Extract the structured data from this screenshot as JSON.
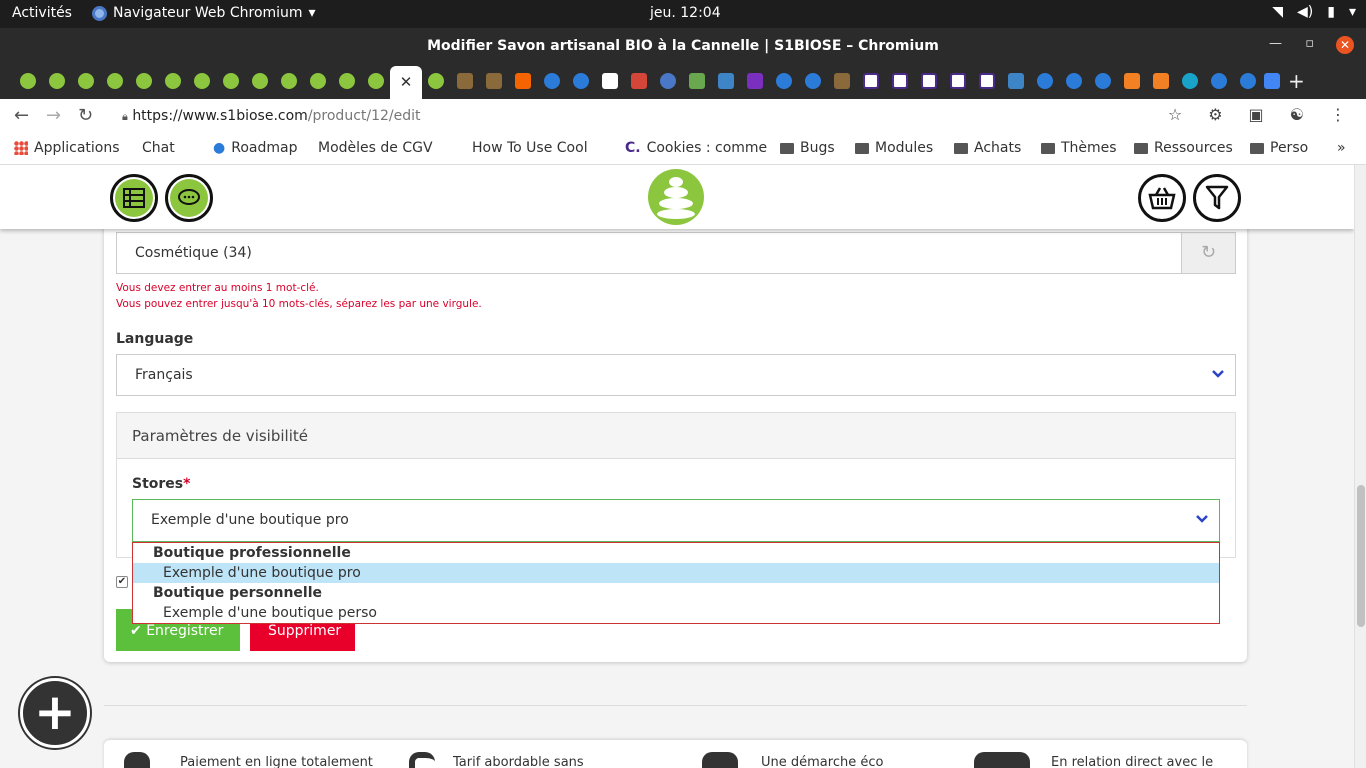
{
  "system": {
    "activities": "Activités",
    "app_name": "Navigateur Web Chromium",
    "clock": "jeu. 12:04"
  },
  "window": {
    "title": "Modifier Savon artisanal BIO à la Cannelle | S1BIOSE – Chromium"
  },
  "address_bar": {
    "host": "https://www.s1biose.com",
    "path": "/product/12/edit"
  },
  "bookmarks": [
    {
      "label": "Applications",
      "icon": "apps-icon"
    },
    {
      "label": "Chat",
      "icon": "page-icon"
    },
    {
      "label": "Roadmap",
      "icon": "drupal-icon"
    },
    {
      "label": "Modèles de CGV",
      "icon": "page-icon"
    },
    {
      "label": "How To Use Cool",
      "icon": "page-icon"
    },
    {
      "label": "Cookies : comme",
      "icon": "c-icon"
    },
    {
      "label": "Bugs",
      "icon": "folder-icon"
    },
    {
      "label": "Modules",
      "icon": "folder-icon"
    },
    {
      "label": "Achats",
      "icon": "folder-icon"
    },
    {
      "label": "Thèmes",
      "icon": "folder-icon"
    },
    {
      "label": "Ressources",
      "icon": "folder-icon"
    },
    {
      "label": "Perso",
      "icon": "folder-icon"
    },
    {
      "label": "»",
      "icon": ""
    }
  ],
  "form": {
    "keywords_value": "Cosmétique (34)",
    "keywords_error_1": "Vous devez entrer au moins 1 mot-clé.",
    "keywords_error_2": "Vous pouvez entrer jusqu'à 10 mots-clés, séparez les par une virgule.",
    "language_label": "Language",
    "language_value": "Français",
    "visibility_heading": "Paramètres de visibilité",
    "stores_label": "Stores",
    "stores_required": "*",
    "stores_value": "Exemple d'une boutique pro",
    "stores_options": [
      {
        "group": "Boutique professionnelle",
        "options": [
          "Exemple d'une boutique pro"
        ]
      },
      {
        "group": "Boutique personnelle",
        "options": [
          "Exemple d'une boutique perso"
        ]
      }
    ],
    "save_label": "Enregistrer",
    "delete_label": "Supprimer"
  },
  "features": [
    "Paiement en ligne totalement",
    "Tarif abordable sans",
    "Une démarche éco",
    "En relation direct avec le"
  ],
  "colors": {
    "brand_green": "#8cc63f",
    "error_red": "#d9002b",
    "save_green": "#5cc03c",
    "delete_red": "#e8002a",
    "option_highlight": "#bde4f7"
  }
}
